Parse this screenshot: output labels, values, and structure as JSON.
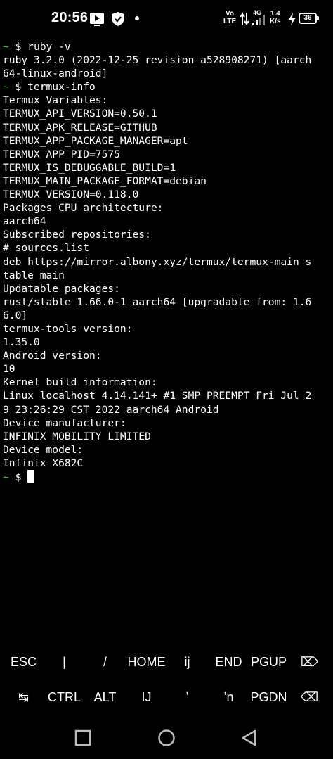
{
  "status_bar": {
    "time": "20:56",
    "left_icons": [
      "screen-record-icon",
      "shield-icon"
    ],
    "volte_top": "Vo",
    "volte_bottom": "LTE",
    "signal_label": "4G",
    "speed_value": "1.4",
    "speed_unit": "K/s",
    "battery": "36"
  },
  "terminal": {
    "lines": [
      {
        "prompt": "~ $ ",
        "text": "ruby -v"
      },
      {
        "text": "ruby 3.2.0 (2022-12-25 revision a528908271) [aarch"
      },
      {
        "text": "64-linux-android]"
      },
      {
        "prompt": "~ $ ",
        "text": "termux-info"
      },
      {
        "text": "Termux Variables:"
      },
      {
        "text": "TERMUX_API_VERSION=0.50.1"
      },
      {
        "text": "TERMUX_APK_RELEASE=GITHUB"
      },
      {
        "text": "TERMUX_APP_PACKAGE_MANAGER=apt"
      },
      {
        "text": "TERMUX_APP_PID=7575"
      },
      {
        "text": "TERMUX_IS_DEBUGGABLE_BUILD=1"
      },
      {
        "text": "TERMUX_MAIN_PACKAGE_FORMAT=debian"
      },
      {
        "text": "TERMUX_VERSION=0.118.0"
      },
      {
        "text": "Packages CPU architecture:"
      },
      {
        "text": "aarch64"
      },
      {
        "text": "Subscribed repositories:"
      },
      {
        "text": "# sources.list"
      },
      {
        "text": "deb https://mirror.albony.xyz/termux/termux-main s"
      },
      {
        "text": "table main"
      },
      {
        "text": "Updatable packages:"
      },
      {
        "text": "rust/stable 1.66.0-1 aarch64 [upgradable from: 1.6"
      },
      {
        "text": "6.0]"
      },
      {
        "text": "termux-tools version:"
      },
      {
        "text": "1.35.0"
      },
      {
        "text": "Android version:"
      },
      {
        "text": "10"
      },
      {
        "text": "Kernel build information:"
      },
      {
        "text": "Linux localhost 4.14.141+ #1 SMP PREEMPT Fri Jul 2"
      },
      {
        "text": "9 23:26:29 CST 2022 aarch64 Android"
      },
      {
        "text": "Device manufacturer:"
      },
      {
        "text": "INFINIX MOBILITY LIMITED"
      },
      {
        "text": "Device model:"
      },
      {
        "text": "Infinix X682C"
      },
      {
        "prompt": "~ $ ",
        "text": "",
        "cursor": true
      }
    ]
  },
  "extra_keys": {
    "row1": [
      "ESC",
      "|",
      "/",
      "HOME",
      "ij",
      "END",
      "PGUP",
      "⌦"
    ],
    "row2": [
      "↹",
      "CTRL",
      "ALT",
      "IJ",
      "ʼ",
      "ʼn",
      "PGDN",
      "⌫"
    ]
  },
  "nav_bar": {
    "buttons": [
      "recents-square-icon",
      "home-circle-icon",
      "back-triangle-icon"
    ]
  },
  "colors": {
    "background": "#000000",
    "foreground": "#ffffff",
    "prompt_tilde": "#3ec93e"
  }
}
